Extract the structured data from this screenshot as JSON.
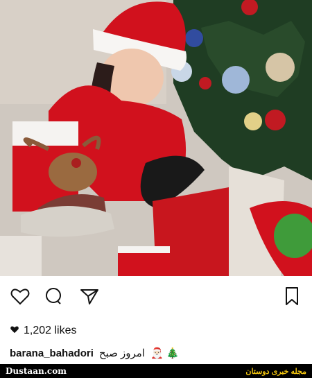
{
  "post": {
    "likes": "1,202 likes",
    "username": "barana_bahadori",
    "caption_text": "امروز صبح",
    "caption_emojis": "🎅🏻 🎄"
  },
  "footer": {
    "site_left": "Dustaan.com",
    "site_right": "مجله خبری دوستان"
  },
  "icons": [
    "heart-icon",
    "comment-icon",
    "share-icon",
    "bookmark-icon",
    "likes-heart-icon"
  ],
  "colors": {
    "santa_red": "#d1111d",
    "tree_green": "#1f3d23",
    "floor": "#cfcaC2",
    "footer_bg": "#000000",
    "footer_right_text": "#f1c40f"
  }
}
